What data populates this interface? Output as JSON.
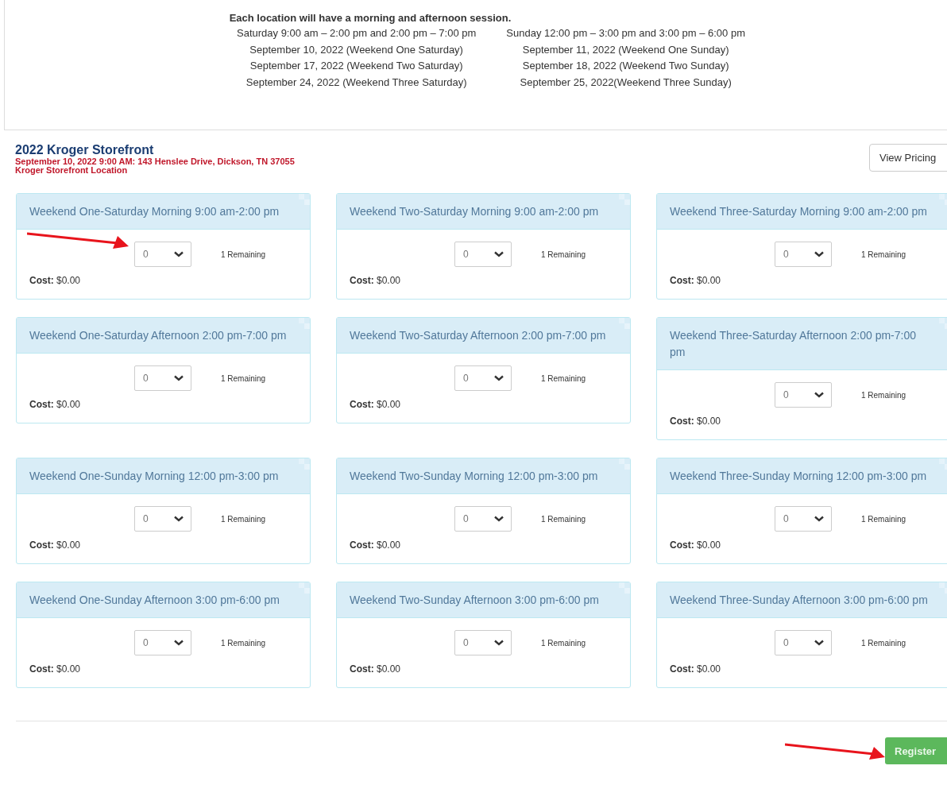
{
  "intro": {
    "heading": "Each location will have a morning and afternoon session.",
    "columns": [
      [
        "Saturday 9:00 am – 2:00 pm and 2:00 pm – 7:00 pm",
        "September 10, 2022 (Weekend One Saturday)",
        "September 17, 2022 (Weekend Two Saturday)",
        "September 24, 2022 (Weekend Three Saturday)"
      ],
      [
        "Sunday 12:00 pm – 3:00 pm and 3:00 pm – 6:00 pm",
        "September 11, 2022 (Weekend One Sunday)",
        "September 18, 2022 (Weekend Two Sunday)",
        "September 25, 2022(Weekend Three Sunday)"
      ]
    ]
  },
  "event": {
    "title": "2022 Kroger Storefront",
    "details": [
      "September 10, 2022 9:00 AM: 143 Henslee Drive, Dickson, TN 37055",
      "Kroger Storefront Location"
    ],
    "view_pricing": "View Pricing"
  },
  "sessions": [
    {
      "title": "Weekend One-Saturday Morning 9:00 am-2:00 pm",
      "quantity": "0",
      "remaining": "1 Remaining",
      "cost_label": "Cost:",
      "cost": "$0.00"
    },
    {
      "title": "Weekend Two-Saturday Morning 9:00 am-2:00 pm",
      "quantity": "0",
      "remaining": "1 Remaining",
      "cost_label": "Cost:",
      "cost": "$0.00"
    },
    {
      "title": "Weekend Three-Saturday Morning 9:00 am-2:00 pm",
      "quantity": "0",
      "remaining": "1 Remaining",
      "cost_label": "Cost:",
      "cost": "$0.00"
    },
    {
      "title": "Weekend One-Saturday Afternoon 2:00 pm-7:00 pm",
      "quantity": "0",
      "remaining": "1 Remaining",
      "cost_label": "Cost:",
      "cost": "$0.00"
    },
    {
      "title": "Weekend Two-Saturday Afternoon 2:00 pm-7:00 pm",
      "quantity": "0",
      "remaining": "1 Remaining",
      "cost_label": "Cost:",
      "cost": "$0.00"
    },
    {
      "title": "Weekend Three-Saturday Afternoon 2:00 pm-7:00 pm",
      "quantity": "0",
      "remaining": "1 Remaining",
      "cost_label": "Cost:",
      "cost": "$0.00"
    },
    {
      "title": "Weekend One-Sunday Morning 12:00 pm-3:00 pm",
      "quantity": "0",
      "remaining": "1 Remaining",
      "cost_label": "Cost:",
      "cost": "$0.00"
    },
    {
      "title": "Weekend Two-Sunday Morning 12:00 pm-3:00 pm",
      "quantity": "0",
      "remaining": "1 Remaining",
      "cost_label": "Cost:",
      "cost": "$0.00"
    },
    {
      "title": "Weekend Three-Sunday Morning 12:00 pm-3:00 pm",
      "quantity": "0",
      "remaining": "1 Remaining",
      "cost_label": "Cost:",
      "cost": "$0.00"
    },
    {
      "title": "Weekend One-Sunday Afternoon 3:00 pm-6:00 pm",
      "quantity": "0",
      "remaining": "1 Remaining",
      "cost_label": "Cost:",
      "cost": "$0.00"
    },
    {
      "title": "Weekend Two-Sunday Afternoon 3:00 pm-6:00 pm",
      "quantity": "0",
      "remaining": "1 Remaining",
      "cost_label": "Cost:",
      "cost": "$0.00"
    },
    {
      "title": "Weekend Three-Sunday Afternoon 3:00 pm-6:00 pm",
      "quantity": "0",
      "remaining": "1 Remaining",
      "cost_label": "Cost:",
      "cost": "$0.00"
    }
  ],
  "register": "Register"
}
